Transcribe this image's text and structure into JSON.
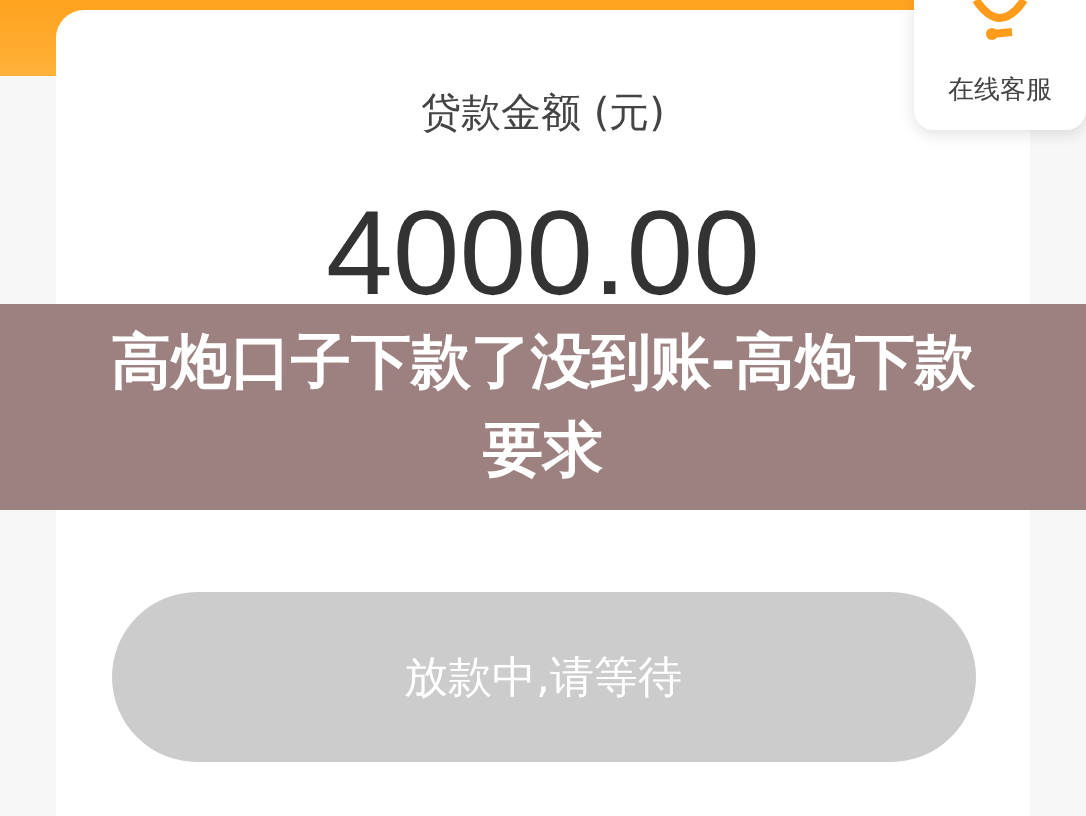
{
  "service_badge": {
    "label": "在线客服"
  },
  "loan": {
    "label": "贷款金额 (元)",
    "amount": "4000.00"
  },
  "submit_button": {
    "label": "放款中,请等待",
    "disabled": true
  },
  "banner": {
    "title": "高炮口子下款了没到账-高炮下款要求"
  }
}
